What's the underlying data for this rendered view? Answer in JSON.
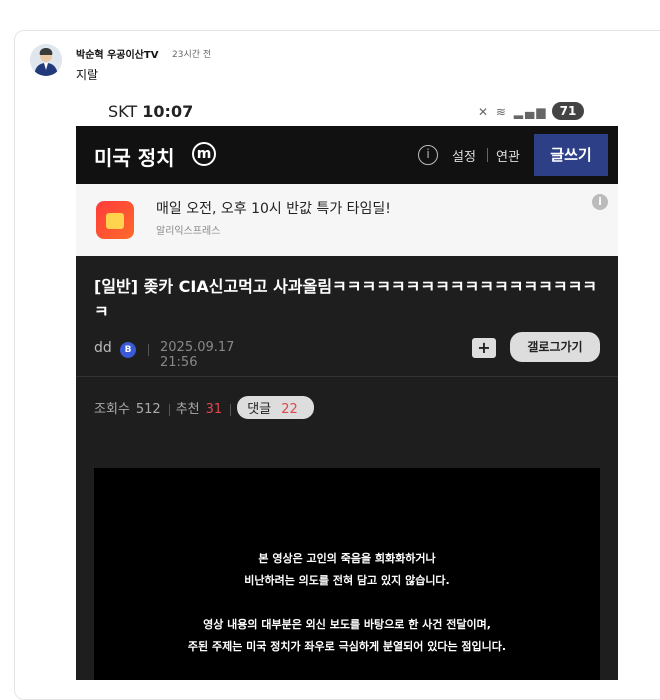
{
  "comment": {
    "author": "박순혁 우공이산TV",
    "time": "23시간 전",
    "text": "지랄"
  },
  "screenshot": {
    "status_bar": {
      "carrier": "SKT",
      "clock": "10:07",
      "battery": "71"
    },
    "app_bar": {
      "title": "미국 정치",
      "minor_badge": "m",
      "nav_settings": "설정",
      "nav_related": "연관",
      "write_button": "글쓰기"
    },
    "ad": {
      "headline": "매일 오전, 오후 10시 반값 특가 타임딜!",
      "brand": "알리익스프레스"
    },
    "post": {
      "title": "[일반] 좆카 CIA신고먹고 사과올림ㅋㅋㅋㅋㅋㅋㅋㅋㅋㅋㅋㅋㅋㅋㅋㅋㅋㅋㅋ",
      "author": "dd",
      "author_badge": "B",
      "date": "2025.09.17 21:56",
      "gallery_button": "갤로그가기",
      "views_label": "조회수",
      "views": "512",
      "recommend_label": "추천",
      "recommend": "31",
      "comments_label": "댓글",
      "comments": "22"
    },
    "video_text": {
      "line1": "본 영상은 고인의 죽음을 희화화하거나",
      "line2": "비난하려는 의도를 전혀 담고 있지 않습니다.",
      "line3": "영상 내용의 대부분은 외신 보도를 바탕으로 한 사건 전달이며,",
      "line4": "주된 주제는 미국 정치가 좌우로 극심하게 분열되어 있다는 점입니다."
    }
  },
  "colors": {
    "app_bar": "#111111",
    "write_button": "#2d3f86",
    "post_bg": "#1e1e1e",
    "accent_red": "#e0474e"
  }
}
